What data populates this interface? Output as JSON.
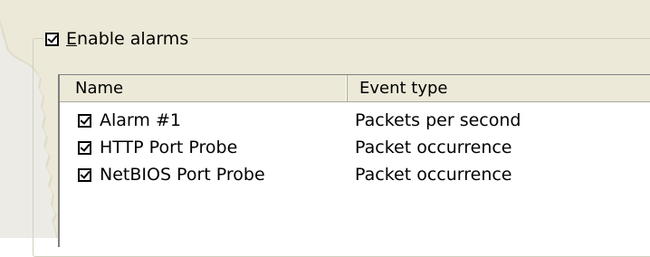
{
  "group": {
    "label_prefix": "",
    "label_mnemonic": "E",
    "label_rest": "nable alarms",
    "checked": true
  },
  "listview": {
    "columns": [
      "Name",
      "Event type"
    ],
    "rows": [
      {
        "checked": true,
        "name": "Alarm #1",
        "event_type": "Packets per second"
      },
      {
        "checked": true,
        "name": "HTTP Port Probe",
        "event_type": "Packet occurrence"
      },
      {
        "checked": true,
        "name": "NetBIOS Port Probe",
        "event_type": "Packet occurrence"
      }
    ]
  },
  "colors": {
    "dialog_bg": "#ece9d8",
    "list_bg": "#ffffff"
  }
}
